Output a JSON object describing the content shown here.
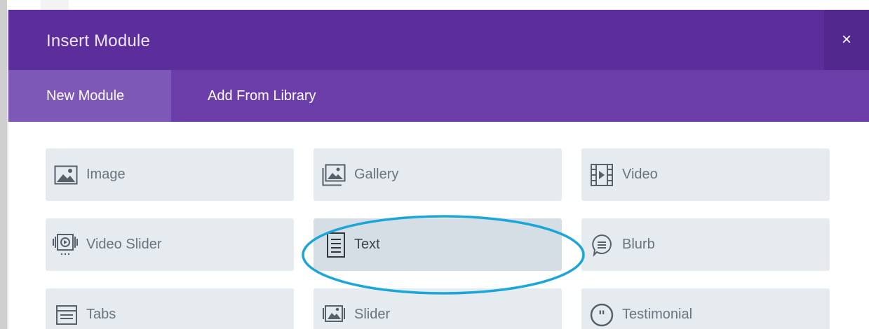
{
  "modal": {
    "title": "Insert Module",
    "close_label": "×"
  },
  "tabs": [
    {
      "label": "New Module",
      "active": true
    },
    {
      "label": "Add From Library",
      "active": false
    }
  ],
  "modules": [
    {
      "label": "Image",
      "icon": "image-icon"
    },
    {
      "label": "Gallery",
      "icon": "gallery-icon"
    },
    {
      "label": "Video",
      "icon": "video-icon"
    },
    {
      "label": "Video Slider",
      "icon": "video-slider-icon"
    },
    {
      "label": "Text",
      "icon": "text-icon",
      "highlighted": true
    },
    {
      "label": "Blurb",
      "icon": "blurb-icon"
    },
    {
      "label": "Tabs",
      "icon": "tabs-icon"
    },
    {
      "label": "Slider",
      "icon": "slider-icon"
    },
    {
      "label": "Testimonial",
      "icon": "testimonial-icon"
    }
  ],
  "colors": {
    "header": "#5b2e9c",
    "tab_bar": "#6a3da9",
    "tab_active": "#7e58b6",
    "module_bg": "#e6ebef",
    "module_text": "#69757e",
    "annotation": "#1aa6d8"
  }
}
